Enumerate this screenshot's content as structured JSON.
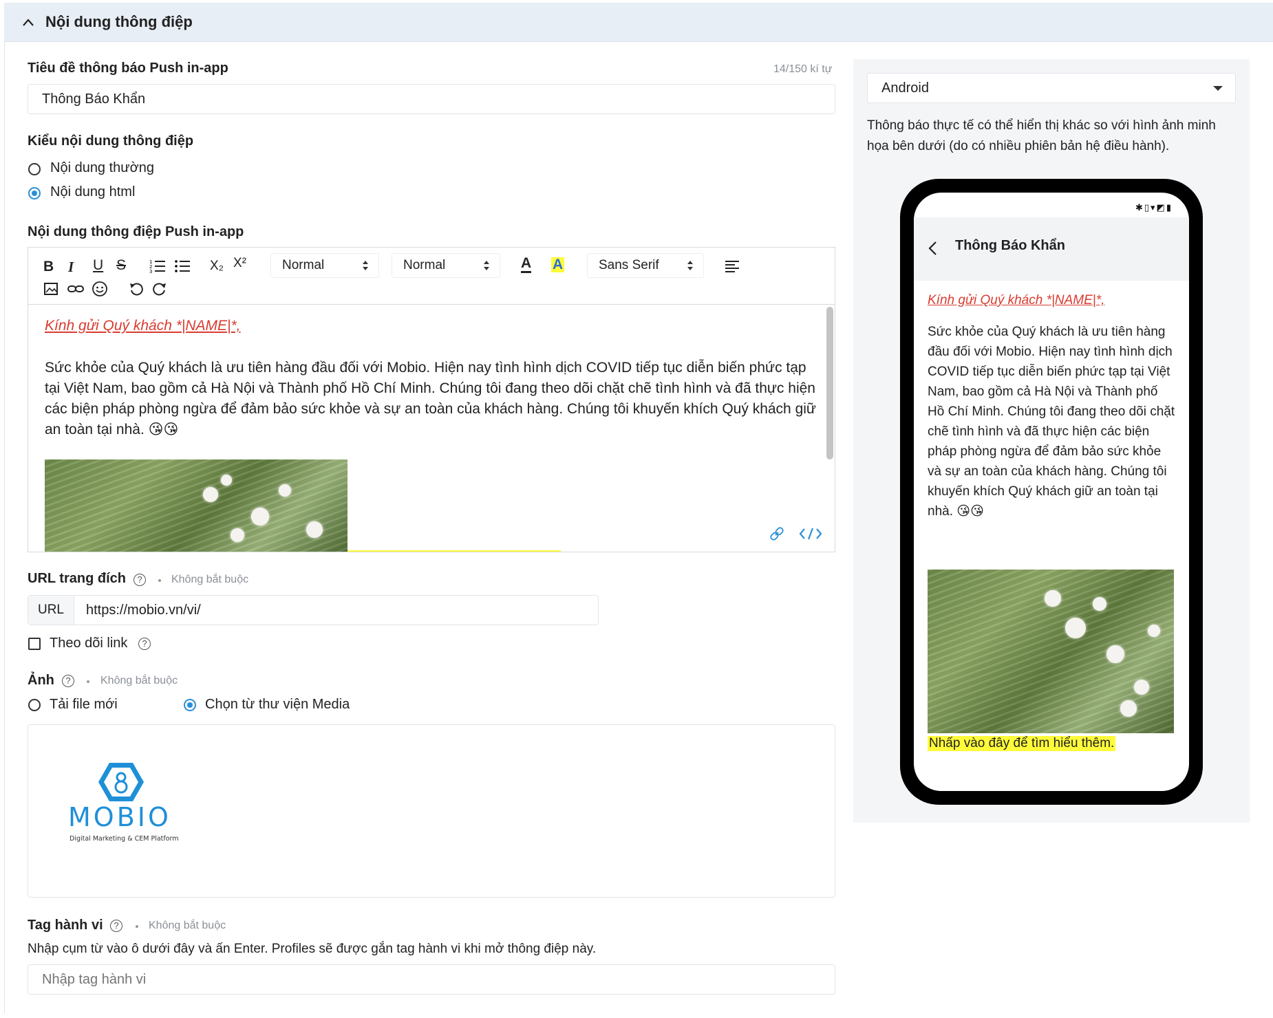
{
  "section": {
    "title": "Nội dung thông điệp"
  },
  "title_field": {
    "label": "Tiêu đề thông báo Push in-app",
    "counter": "14/150 kí tự",
    "value": "Thông Báo Khẩn"
  },
  "content_type": {
    "label": "Kiểu nội dung thông điệp",
    "options": [
      {
        "label": "Nội dung thường",
        "selected": false
      },
      {
        "label": "Nội dung html",
        "selected": true
      }
    ]
  },
  "editor": {
    "label": "Nội dung thông điệp Push in-app",
    "toolbar": {
      "bold": "B",
      "italic": "I",
      "underline": "U",
      "strike": "S",
      "sub": "X₂",
      "sup": "X²",
      "size_select": "Normal",
      "header_select": "Normal",
      "font_select": "Sans Serif",
      "color_letter": "A",
      "bg_letter": "A"
    },
    "greeting": "Kính gửi Quý khách *|NAME|*,",
    "body": "Sức khỏe của Quý khách là ưu tiên hàng đầu đối với Mobio. Hiện nay tình hình dịch COVID tiếp tục diễn biến phức tạp tại Việt Nam, bao gồm cả Hà Nội và Thành phố Hồ Chí Minh. Chúng tôi đang theo dõi chặt chẽ tình hình và đã thực hiện các biện pháp phòng ngừa để đảm bảo sức khỏe và sự an toàn của khách hàng. Chúng tôi khuyến khích Quý khách giữ an toàn tại nhà. 😘😘"
  },
  "url_field": {
    "label": "URL trang đích",
    "optional": "Không bắt buộc",
    "addon": "URL",
    "value": "https://mobio.vn/vi/"
  },
  "track_link": {
    "label": "Theo dõi link",
    "checked": false
  },
  "image_field": {
    "label": "Ảnh",
    "optional": "Không bắt buộc",
    "options": [
      {
        "label": "Tải file mới",
        "selected": false
      },
      {
        "label": "Chọn từ thư viện Media",
        "selected": true
      }
    ],
    "logo_text": "MOBIO",
    "logo_tagline": "Digital Marketing & CEM Platform"
  },
  "tag_field": {
    "label": "Tag hành vi",
    "optional": "Không bắt buộc",
    "hint": "Nhập cụm từ vào ô dưới đây và ấn Enter. Profiles sẽ được gắn tag hành vi khi mở thông điệp này.",
    "placeholder": "Nhập tag hành vi"
  },
  "preview": {
    "platform": "Android",
    "note": "Thông báo thực tế có thể hiển thị khác so với hình ảnh minh họa bên dưới (do có nhiều phiên bản hệ điều hành).",
    "header_title": "Thông Báo Khẩn",
    "greeting": "Kính gửi Quý khách *|NAME|*,",
    "body": "Sức khỏe của Quý khách là ưu tiên hàng đầu đối với Mobio. Hiện nay tình hình dịch COVID tiếp tục diễn biến phức tạp tại Việt Nam, bao gồm cả Hà Nội và Thành phố Hồ Chí Minh. Chúng tôi đang theo dõi chặt chẽ tình hình và đã thực hiện các biện pháp phòng ngừa để đảm bảo sức khỏe và sự an toàn của khách hàng. Chúng tôi khuyến khích Quý khách giữ an toàn tại nhà. 😘😘",
    "cta": "Nhấp vào đây để tìm hiểu thêm."
  },
  "colors": {
    "accent": "#2a8fd6",
    "link_red": "#d93b30",
    "highlight": "#fffb3a",
    "header_bg": "#e8eef5"
  }
}
